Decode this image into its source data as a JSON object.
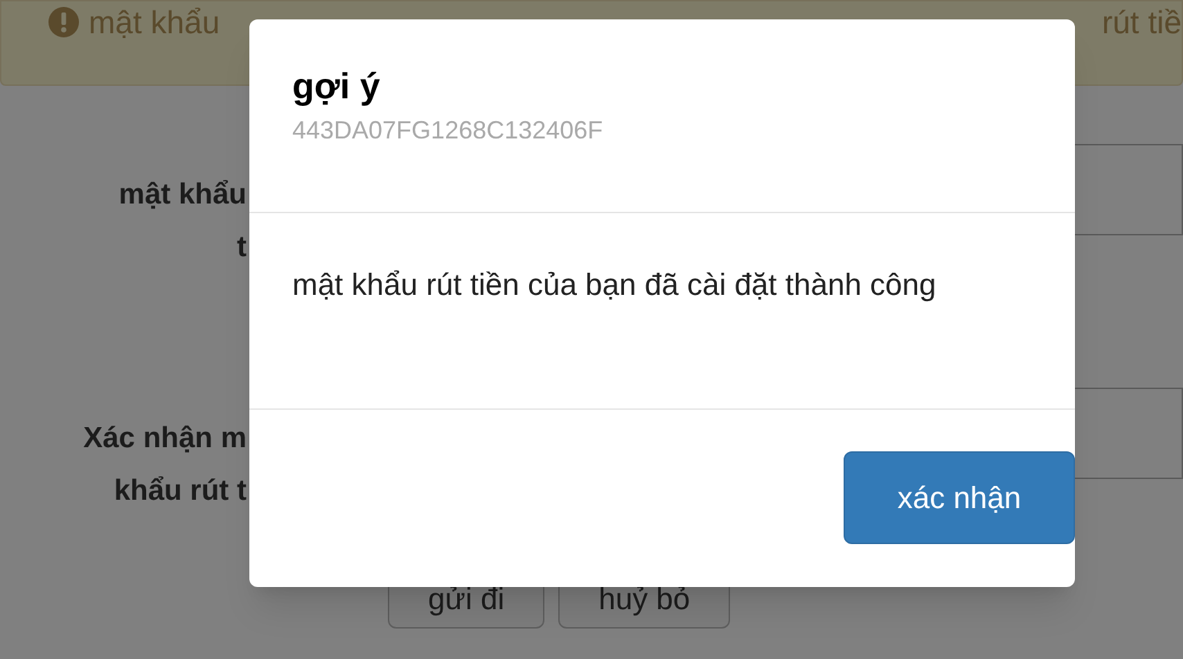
{
  "alert": {
    "text_left": "mật khẩu",
    "text_right": "rút tiề"
  },
  "form": {
    "fields": [
      {
        "label_lines": [
          "mật khẩu",
          "t"
        ]
      },
      {
        "label_lines": [
          "Xác nhận m",
          "khẩu rút t"
        ]
      }
    ],
    "buttons": [
      "gửi đi",
      "huỷ bỏ"
    ]
  },
  "dialog": {
    "title": "gợi ý",
    "code": "443DA07FG1268C132406F",
    "message": "mật khẩu rút tiền của bạn đã cài đặt thành công",
    "confirm_button": "xác nhận"
  }
}
